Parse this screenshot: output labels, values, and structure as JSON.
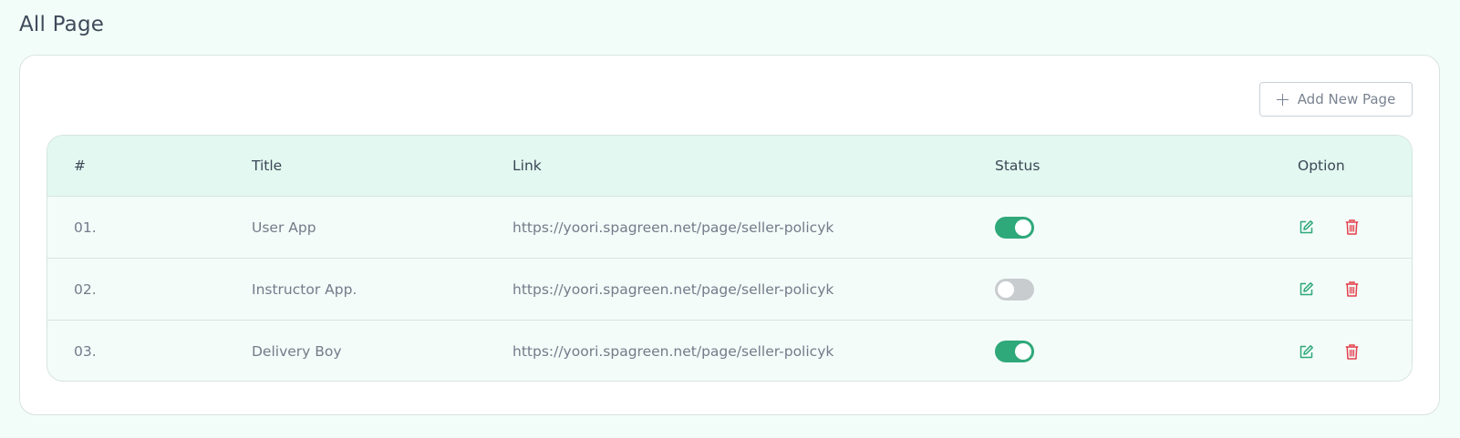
{
  "page": {
    "title": "All Page"
  },
  "toolbar": {
    "add_label": "Add New Page",
    "add_icon": "plus-icon"
  },
  "table": {
    "columns": [
      "#",
      "Title",
      "Link",
      "Status",
      "Option"
    ],
    "rows": [
      {
        "num": "01.",
        "title": "User App",
        "link": "https://yoori.spagreen.net/page/seller-policyk",
        "status": "on"
      },
      {
        "num": "02.",
        "title": "Instructor App.",
        "link": "https://yoori.spagreen.net/page/seller-policyk",
        "status": "off"
      },
      {
        "num": "03.",
        "title": "Delivery Boy",
        "link": "https://yoori.spagreen.net/page/seller-policyk",
        "status": "on"
      }
    ]
  },
  "colors": {
    "accent_green": "#2fa87a",
    "danger_red": "#e53e4b",
    "header_bg": "#e2f8f0",
    "page_bg": "#f2fdf9"
  },
  "icons": {
    "edit": "edit-icon",
    "delete": "trash-icon"
  }
}
